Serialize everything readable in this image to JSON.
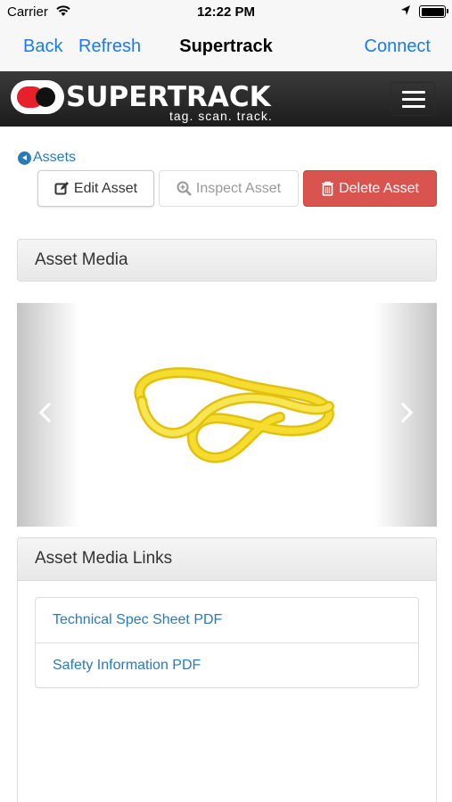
{
  "status_bar": {
    "carrier": "Carrier",
    "time": "12:22 PM"
  },
  "nav_bar": {
    "back_label": "Back",
    "refresh_label": "Refresh",
    "title": "Supertrack",
    "connect_label": "Connect"
  },
  "brand": {
    "name": "SUPERTRACK",
    "tagline": "tag. scan. track."
  },
  "breadcrumb": {
    "label": "Assets"
  },
  "actions": {
    "edit_label": "Edit Asset",
    "inspect_label": "Inspect Asset",
    "delete_label": "Delete Asset"
  },
  "media_panel": {
    "title": "Asset Media"
  },
  "links_panel": {
    "title": "Asset Media Links",
    "links": [
      {
        "label": "Technical Spec Sheet PDF"
      },
      {
        "label": "Safety Information PDF"
      }
    ]
  },
  "colors": {
    "link": "#2a7ab8",
    "ios_blue": "#1a7be8",
    "danger": "#d9534f",
    "sling_yellow": "#f2d21b"
  },
  "icons": [
    "wifi-icon",
    "location-icon",
    "battery-icon",
    "hamburger-menu-icon",
    "back-circle-icon",
    "edit-icon",
    "search-plus-icon",
    "trash-icon",
    "chevron-left-icon",
    "chevron-right-icon"
  ]
}
